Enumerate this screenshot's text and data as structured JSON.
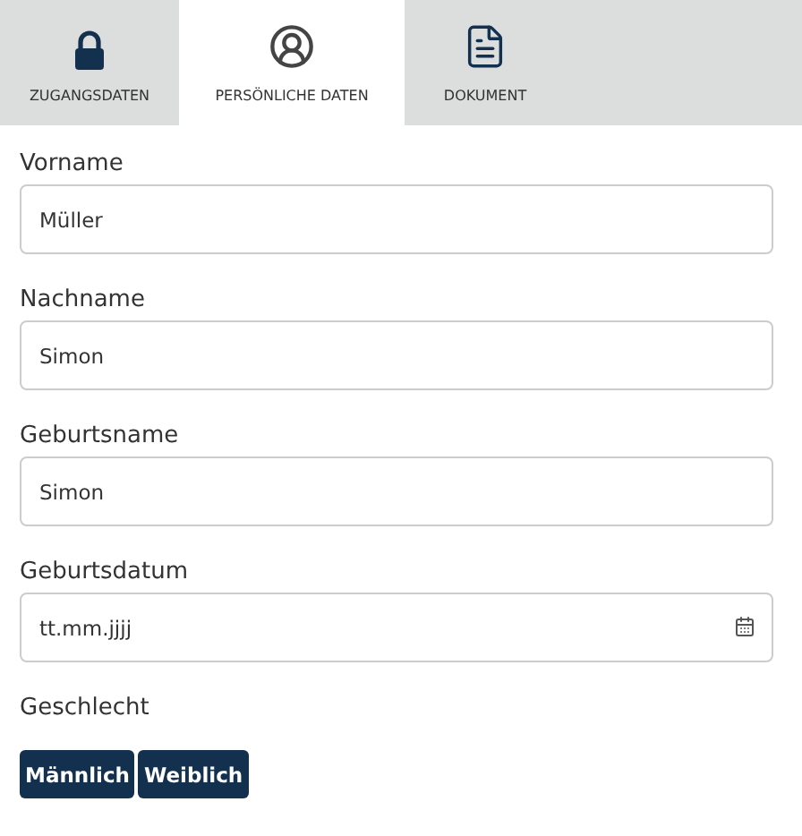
{
  "tabs": [
    {
      "label": "ZUGANGSDATEN",
      "kind": "lock",
      "selected": false
    },
    {
      "label": "PERSÖNLICHE DATEN",
      "kind": "person",
      "selected": true
    },
    {
      "label": "DOKUMENT",
      "kind": "document",
      "selected": false
    }
  ],
  "fields": [
    {
      "label": "Vorname",
      "value": "Müller",
      "kind": "text"
    },
    {
      "label": "Nachname",
      "value": "Simon",
      "kind": "text"
    },
    {
      "label": "Geburtsname",
      "value": "Simon",
      "kind": "text"
    },
    {
      "label": "Geburtsdatum",
      "placeholder": "tt.mm.jjjj",
      "kind": "date"
    }
  ],
  "gender": {
    "label": "Geschlecht",
    "options": [
      "Männlich",
      "Weiblich"
    ]
  }
}
